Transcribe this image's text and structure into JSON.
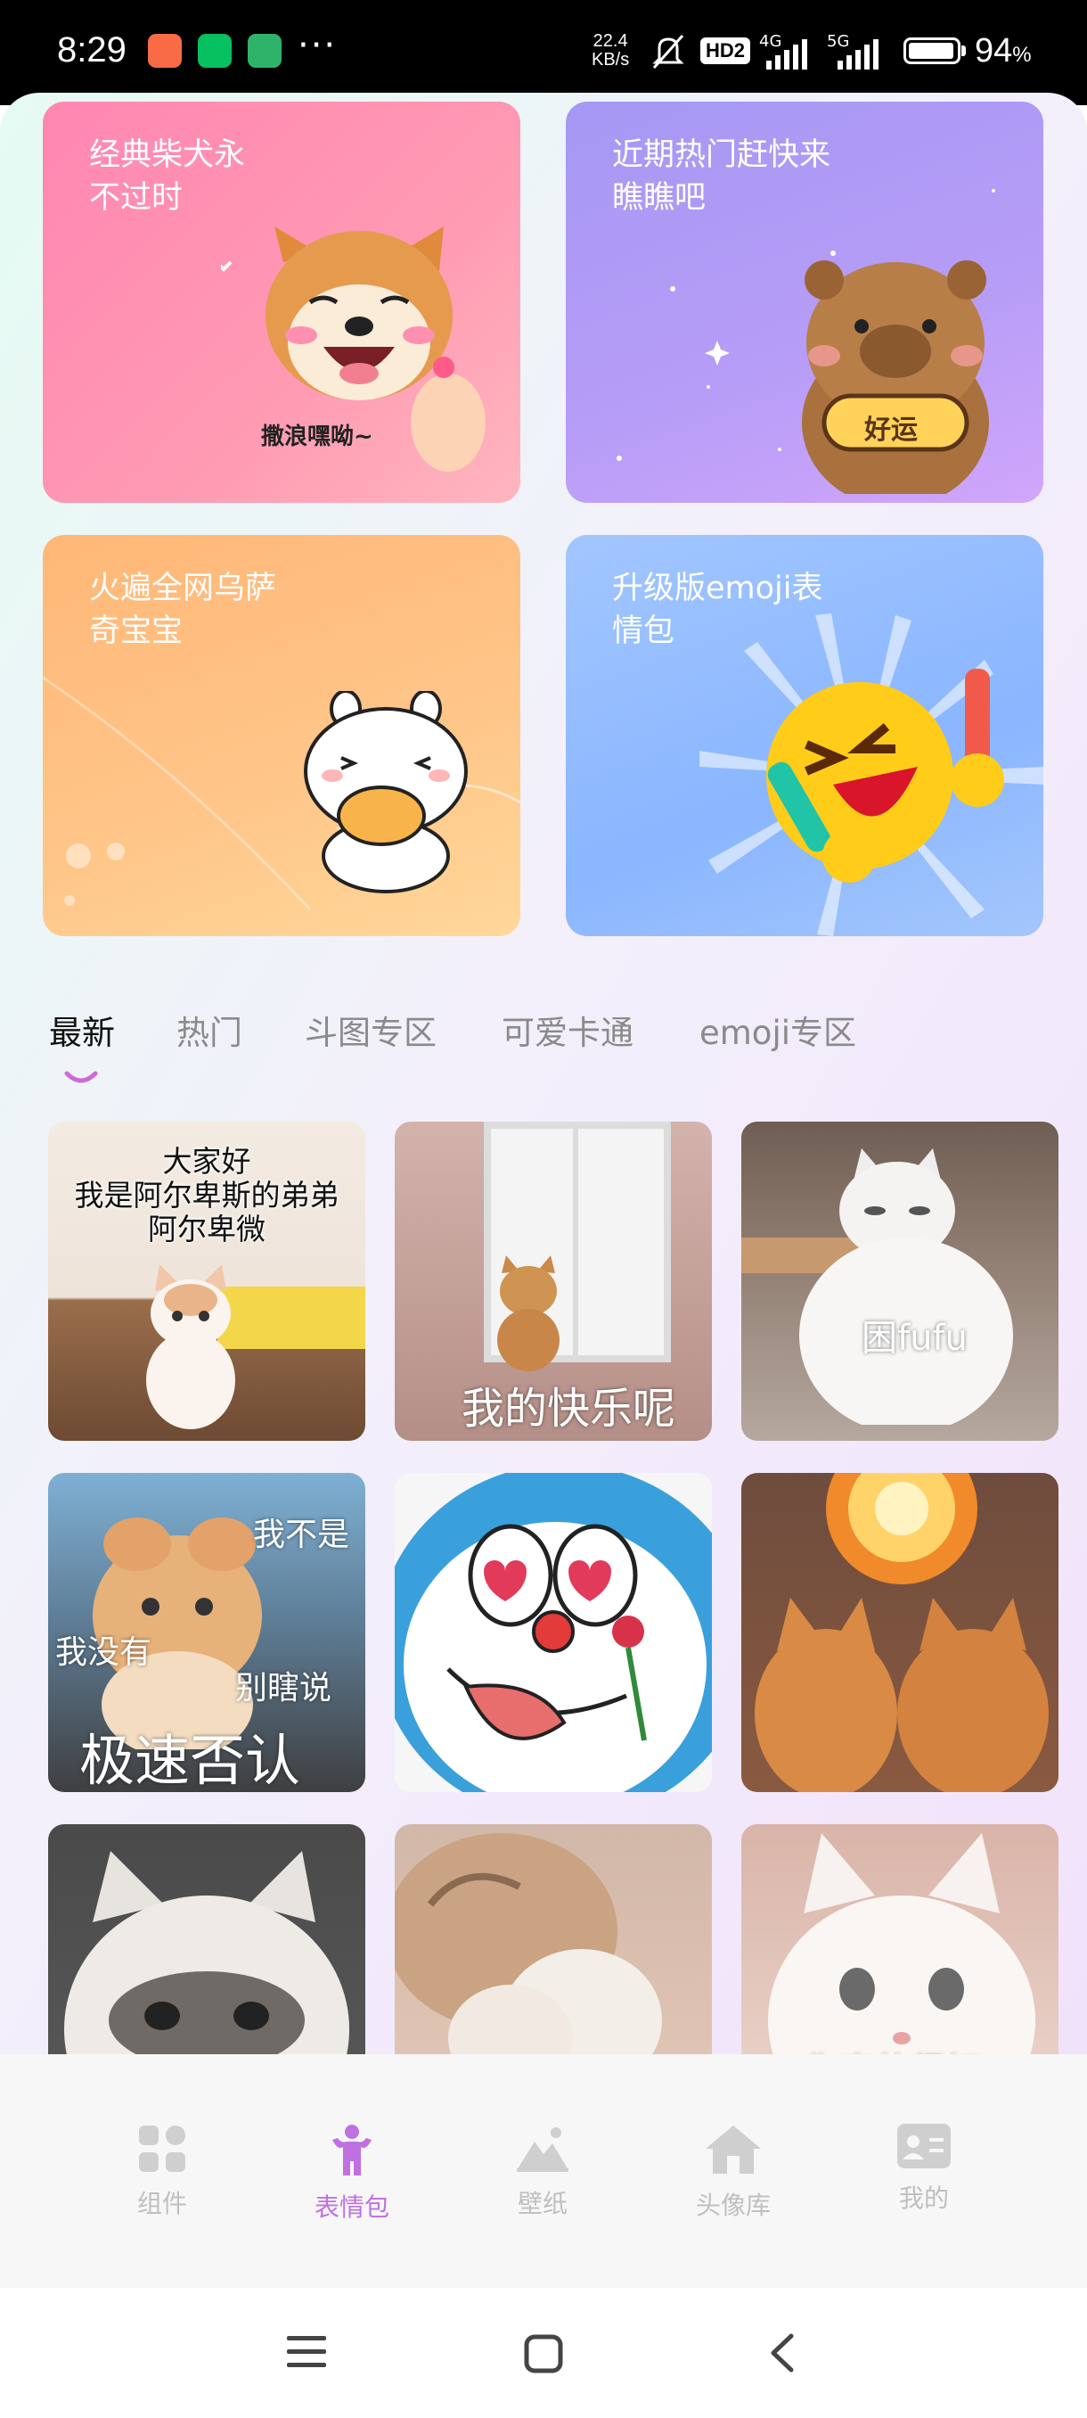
{
  "status_bar": {
    "time": "8:29",
    "app_icon_colors": [
      "#f86b46",
      "#07c160",
      "#2fb36b"
    ],
    "more": "···",
    "net_speed_value": "22.4",
    "net_speed_unit": "KB/s",
    "hd_label": "HD2",
    "sim1_label": "4G",
    "sim2_label": "5G",
    "battery": "94",
    "battery_unit": "%"
  },
  "featured_cards": [
    {
      "title_line1": "经典柴犬永",
      "title_line2": "不过时",
      "sticker_caption": "撒浪嘿呦~"
    },
    {
      "title_line1": "近期热门赶快来",
      "title_line2": "瞧瞧吧",
      "sticker_caption": "好运"
    },
    {
      "title_line1": "火遍全网乌萨",
      "title_line2": "奇宝宝"
    },
    {
      "title_line1": "升级版emoji表",
      "title_line2": "情包"
    }
  ],
  "tabs": [
    {
      "label": "最新",
      "active": true
    },
    {
      "label": "热门",
      "active": false
    },
    {
      "label": "斗图专区",
      "active": false
    },
    {
      "label": "可爱卡通",
      "active": false
    },
    {
      "label": "emoji专区",
      "active": false
    }
  ],
  "stickers": [
    {
      "caption_line1": "大家好",
      "caption_line2": "我是阿尔卑斯的弟弟",
      "caption_line3": "阿尔卑微"
    },
    {
      "caption": "我的快乐呢"
    },
    {
      "caption": "困fufu"
    },
    {
      "caption_a": "我不是",
      "caption_b": "我没有",
      "caption_c": "别瞎说",
      "caption_main": "极速否认"
    },
    {
      "caption": ""
    },
    {
      "caption": ""
    },
    {
      "caption": ""
    },
    {
      "caption": ""
    },
    {
      "caption": "你真的很好"
    }
  ],
  "bottom_nav": [
    {
      "label": "组件",
      "icon": "grid-icon",
      "active": false
    },
    {
      "label": "表情包",
      "icon": "person-icon",
      "active": true
    },
    {
      "label": "壁纸",
      "icon": "mountain-icon",
      "active": false
    },
    {
      "label": "头像库",
      "icon": "house-icon",
      "active": false
    },
    {
      "label": "我的",
      "icon": "id-card-icon",
      "active": false
    }
  ],
  "colors": {
    "accent": "#c070e0",
    "inactive": "#bfbfbf"
  }
}
